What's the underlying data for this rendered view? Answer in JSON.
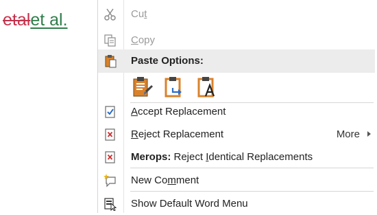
{
  "document": {
    "deleted_text": "etal",
    "inserted_text": "et al."
  },
  "menu": {
    "cut": {
      "pre": "Cu",
      "key": "t",
      "post": "",
      "icon": "scissors-icon"
    },
    "copy": {
      "pre": "",
      "key": "C",
      "post": "opy",
      "icon": "copy-icon"
    },
    "paste_header": {
      "label": "Paste Options:",
      "icon": "clipboard-icon"
    },
    "paste_options": [
      {
        "name": "keep-source-formatting",
        "icon": "paste-keep-formatting-icon"
      },
      {
        "name": "merge-formatting",
        "icon": "paste-merge-formatting-icon"
      },
      {
        "name": "keep-text-only",
        "icon": "paste-text-only-icon"
      }
    ],
    "accept": {
      "pre": "",
      "key": "A",
      "post": "ccept Replacement",
      "icon": "checkmark-document-icon"
    },
    "reject": {
      "pre": "",
      "key": "R",
      "post": "eject Replacement",
      "icon": "x-document-icon",
      "more": "More"
    },
    "merops": {
      "bold": "Merops:",
      "pre": " Reject ",
      "key": "I",
      "post": "dentical Replacements",
      "icon": "x-document-icon"
    },
    "new_comment": {
      "pre": "New Co",
      "key": "m",
      "post": "ment",
      "icon": "new-comment-icon"
    },
    "show_default": {
      "label": "Show Default Word Menu",
      "icon": "word-menu-icon"
    }
  },
  "colors": {
    "deleted": "#c4314b",
    "inserted": "#2e7d4a",
    "header_bg": "#ececec",
    "accent_blue": "#2b6cc4",
    "paste_orange": "#d9822b"
  }
}
